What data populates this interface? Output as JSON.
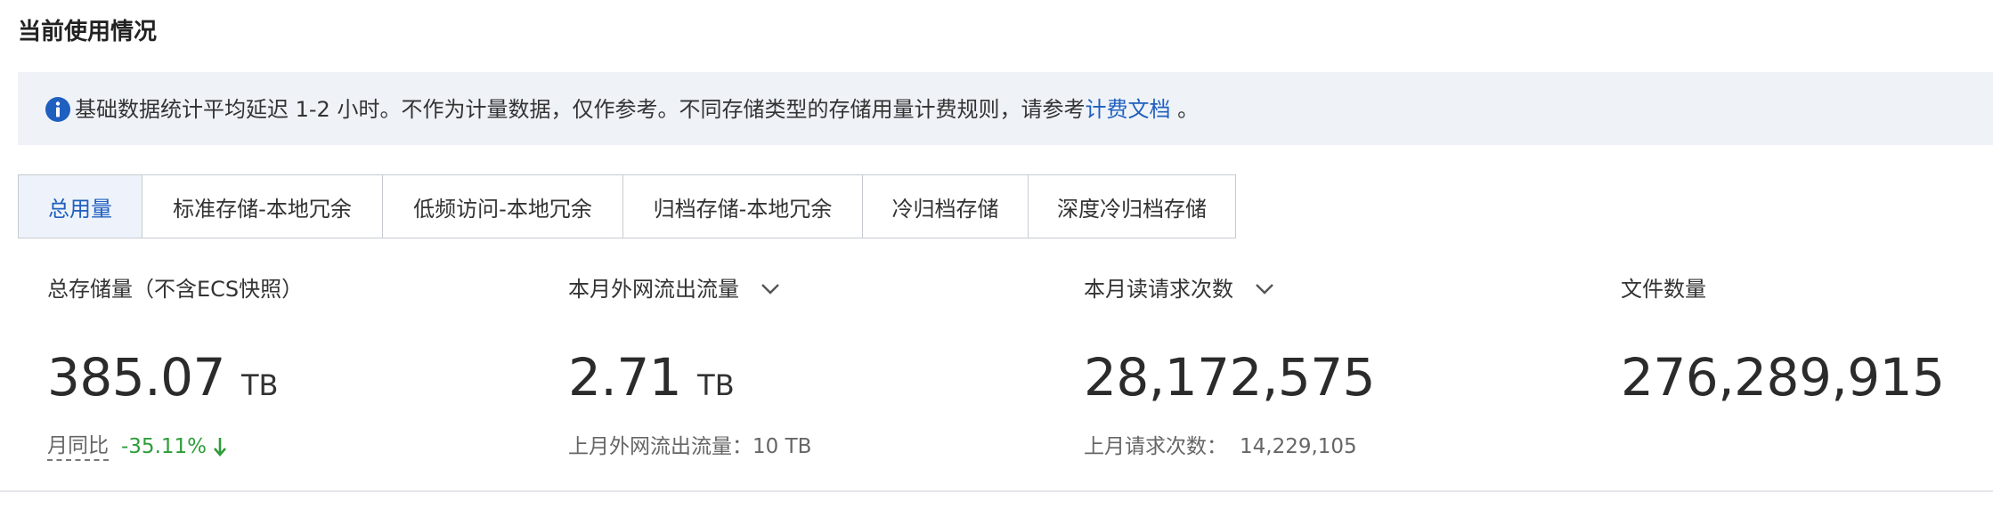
{
  "section_title": "当前使用情况",
  "notice": {
    "text": "基础数据统计平均延迟 1-2 小时。不作为计量数据，仅作参考。不同存储类型的存储用量计费规则，请参考",
    "link": "计费文档",
    "suffix": " 。"
  },
  "tabs": [
    {
      "label": "总用量",
      "active": true
    },
    {
      "label": "标准存储-本地冗余"
    },
    {
      "label": "低频访问-本地冗余"
    },
    {
      "label": "归档存储-本地冗余"
    },
    {
      "label": "冷归档存储"
    },
    {
      "label": "深度冷归档存储"
    }
  ],
  "metrics": {
    "storage": {
      "label": "总存储量（不含ECS快照）",
      "value": "385.07",
      "unit": "TB",
      "compare_label": "月同比",
      "compare_value": "-35.11%"
    },
    "egress": {
      "label": "本月外网流出流量",
      "value": "2.71",
      "unit": "TB",
      "prev_label": "上月外网流出流量：",
      "prev_value": "10 TB"
    },
    "requests": {
      "label": "本月读请求次数",
      "value": "28,172,575",
      "prev_label": "上月请求次数：",
      "prev_value": "14,229,105"
    },
    "files": {
      "label": "文件数量",
      "value": "276,289,915"
    }
  },
  "colors": {
    "link": "#1f5fbf",
    "active_tab_bg": "#eef3fb",
    "notice_bg": "#eff3f8",
    "trend_down": "#2e9d3a"
  }
}
